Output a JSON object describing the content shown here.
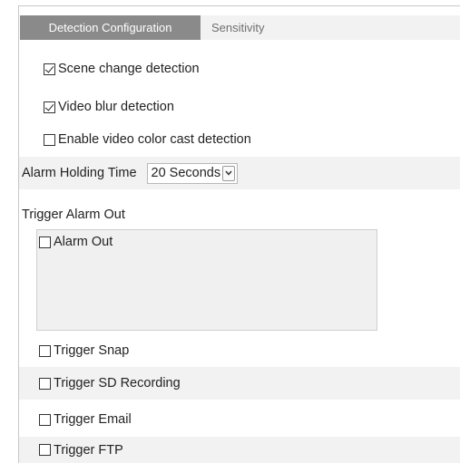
{
  "tabs": [
    {
      "label": "Detection Configuration",
      "active": true
    },
    {
      "label": "Sensitivity",
      "active": false
    }
  ],
  "detection_options": [
    {
      "label": "Scene change detection",
      "checked": true
    },
    {
      "label": "Video blur detection",
      "checked": true
    },
    {
      "label": "Enable video color cast detection",
      "checked": false
    }
  ],
  "alarm_holding": {
    "label": "Alarm Holding Time",
    "selected": "20 Seconds"
  },
  "trigger_alarm_out": {
    "label": "Trigger Alarm Out",
    "items": [
      {
        "label": "Alarm Out",
        "checked": false
      }
    ]
  },
  "triggers": [
    {
      "label": "Trigger Snap",
      "checked": false
    },
    {
      "label": "Trigger SD Recording",
      "checked": false
    },
    {
      "label": "Trigger Email",
      "checked": false
    },
    {
      "label": "Trigger FTP",
      "checked": false
    }
  ],
  "colors": {
    "active_tab_bg": "#8a8a8a",
    "shade_row_bg": "#f2f2f2",
    "alarm_box_bg": "#f0f0f0"
  }
}
